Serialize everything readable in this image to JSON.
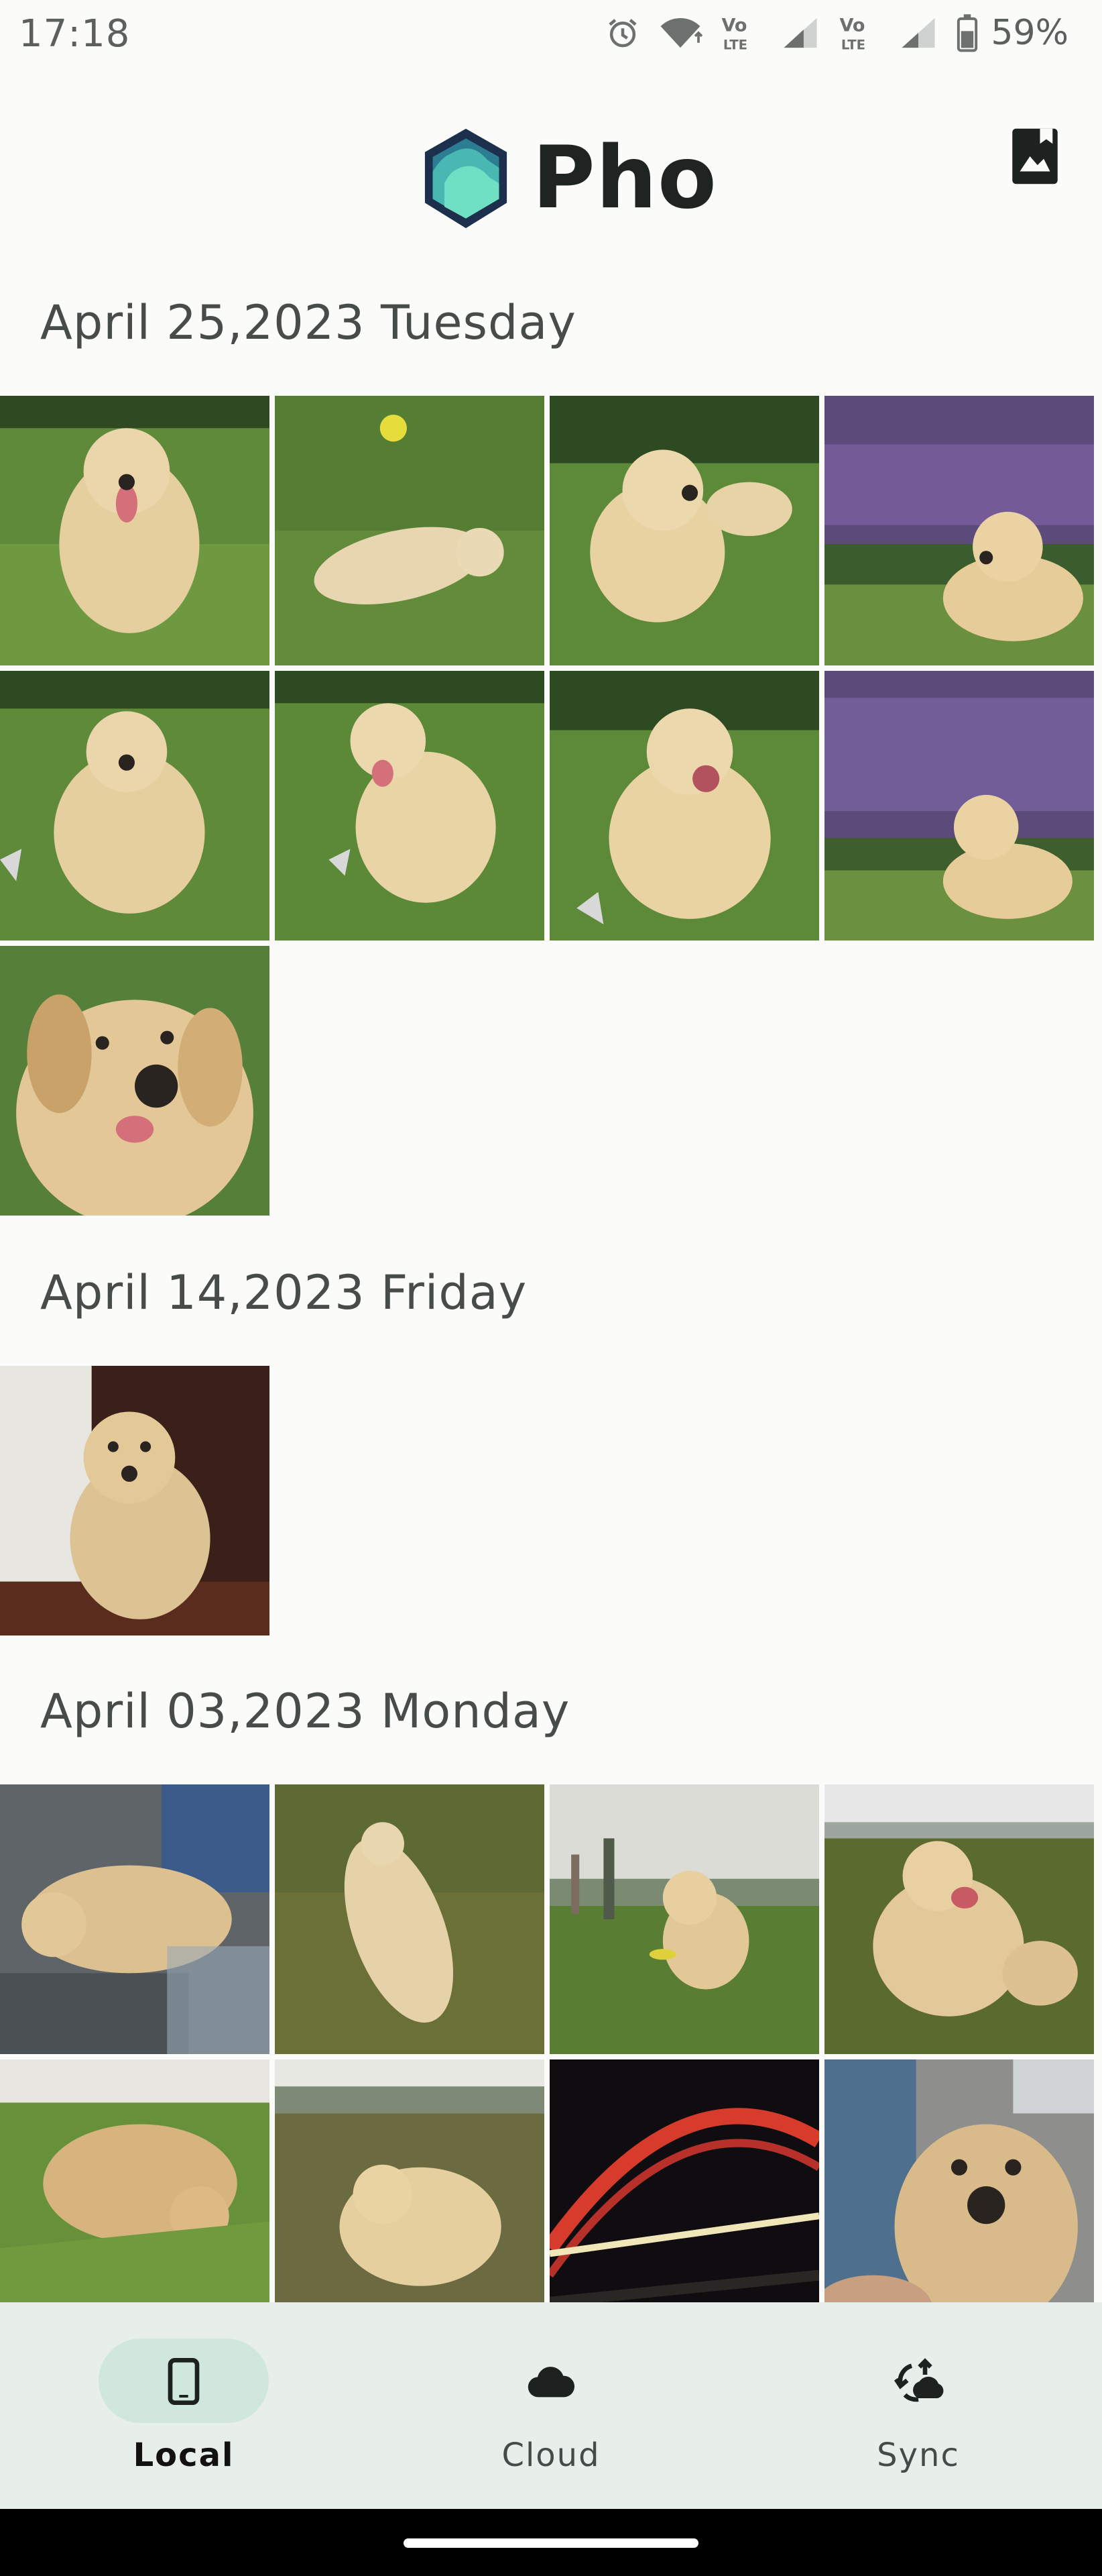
{
  "status_bar": {
    "time": "17:18",
    "battery": "59%"
  },
  "header": {
    "app_name": "Pho",
    "logo_colors": [
      "#1c3f50",
      "#2f8f9a",
      "#6fe0c3"
    ]
  },
  "sections": [
    {
      "label": "April 25,2023 Tuesday",
      "photo_count": 9
    },
    {
      "label": "April 14,2023 Friday",
      "photo_count": 1
    },
    {
      "label": "April 03,2023 Monday",
      "photo_count": 8
    }
  ],
  "bottom_nav": {
    "items": [
      {
        "label": "Local",
        "icon": "phone-icon",
        "active": true
      },
      {
        "label": "Cloud",
        "icon": "cloud-icon",
        "active": false
      },
      {
        "label": "Sync",
        "icon": "sync-icon",
        "active": false
      }
    ]
  },
  "colors": {
    "background": "#fbfcf9",
    "nav_background": "#e8efeb",
    "nav_active_pill": "#cfe7dc"
  }
}
